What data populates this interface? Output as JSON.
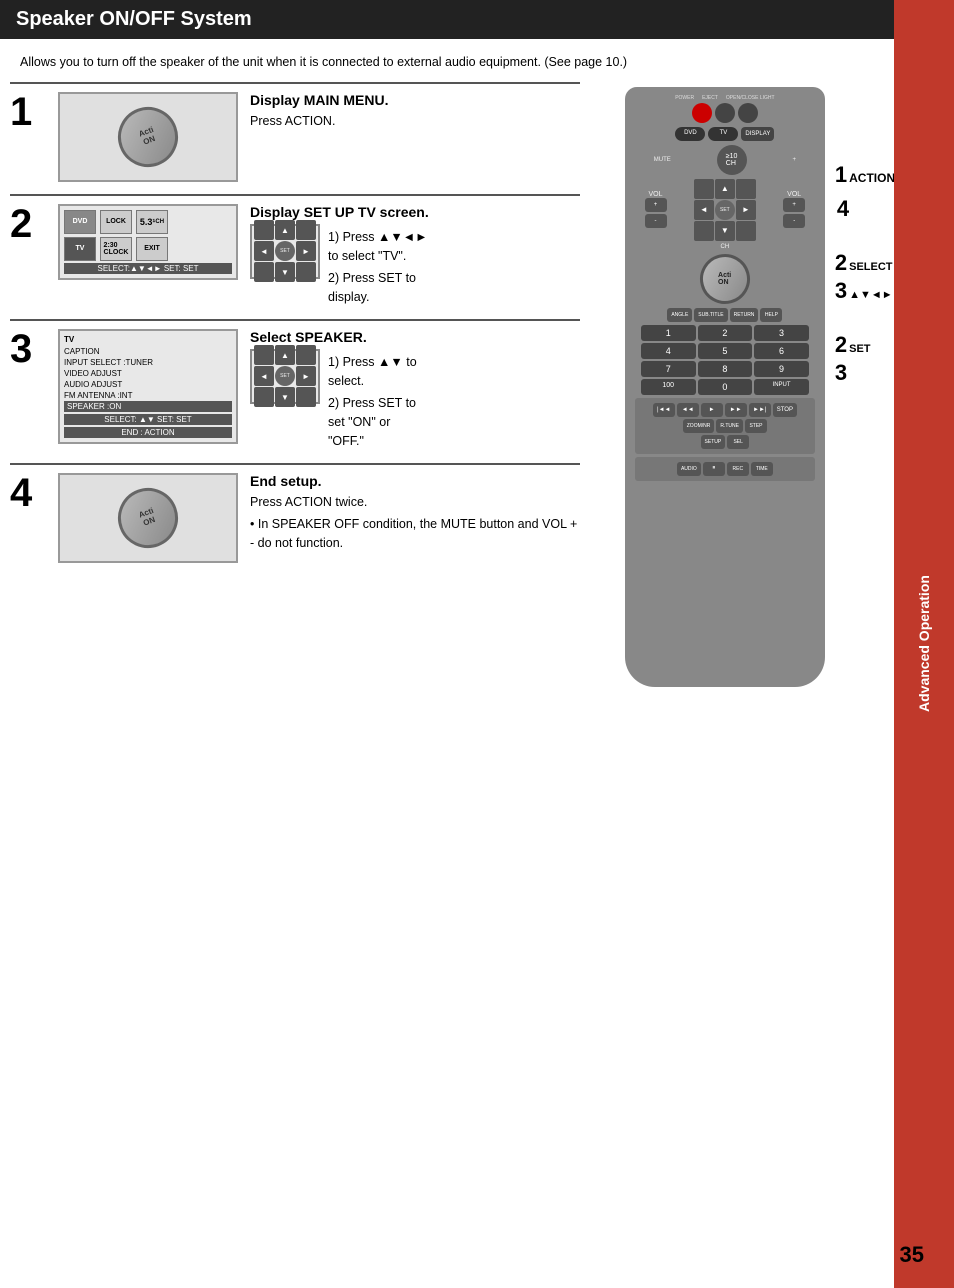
{
  "page": {
    "title": "Speaker ON/OFF System",
    "intro": "Allows you to turn off the speaker of the unit when it is connected to external audio equipment. (See page 10.)",
    "page_number": "35",
    "sidebar_label": "Advanced Operation"
  },
  "steps": [
    {
      "number": "1",
      "heading": "Display MAIN MENU.",
      "desc": "Press ACTION.",
      "image_type": "action_btn"
    },
    {
      "number": "2",
      "heading": "Display SET UP TV screen.",
      "sub_steps": [
        "1) Press ▲▼◄► to select \"TV\".",
        "2) Press SET to display."
      ],
      "image_type": "tv_menu"
    },
    {
      "number": "3",
      "heading": "Select SPEAKER.",
      "sub_steps": [
        "1) Press ▲▼ to select.",
        "2) Press SET to set \"ON\" or \"OFF\"."
      ],
      "image_type": "speaker_menu"
    },
    {
      "number": "4",
      "heading": "End setup.",
      "desc": "Press ACTION twice.",
      "note": "• In SPEAKER OFF condition, the MUTE button and VOL + - do not function.",
      "image_type": "action_btn"
    }
  ],
  "callouts": [
    {
      "num": "1",
      "label": "ACTION"
    },
    {
      "num": "4",
      "label": ""
    },
    {
      "num": "2",
      "label": "SELECT"
    },
    {
      "num": "3",
      "label": "▲▼◄►"
    },
    {
      "num": "2",
      "label": "SET"
    },
    {
      "num": "3",
      "label": ""
    }
  ],
  "screen_step2": {
    "icons": [
      "DVD",
      "LOCK",
      "5.3",
      "CH",
      "TV",
      "CLOCK",
      "EXIT"
    ],
    "bar": "SELECT:▲▼◄►  SET: SET"
  },
  "screen_step3": {
    "title": "TV",
    "items": [
      "CAPTION",
      "INPUT  SELECT  :TUNER",
      "VIDEO  ADJUST",
      "AUDIO  ADJUST",
      "FM ANTENNA  :INT",
      "SPEAKER       :ON"
    ],
    "bar": "SELECT: ▲▼   SET: SET",
    "bar2": "END    : ACTION"
  }
}
